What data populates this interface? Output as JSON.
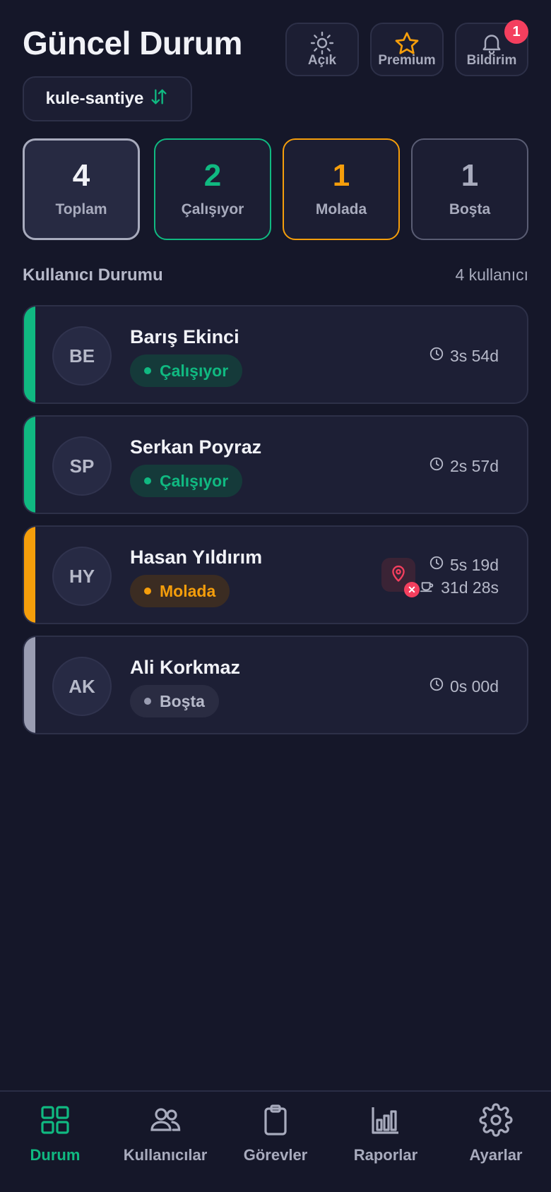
{
  "header": {
    "title": "Güncel Durum",
    "buttons": [
      {
        "label": "Açık",
        "icon": "sun-icon"
      },
      {
        "label": "Premium",
        "icon": "star-icon"
      },
      {
        "label": "Bildirim",
        "icon": "bell-icon",
        "badge": "1"
      }
    ],
    "project": "kule-santiye"
  },
  "stats": [
    {
      "value": "4",
      "label": "Toplam",
      "color": "#f1f2f7"
    },
    {
      "value": "2",
      "label": "Çalışıyor",
      "color": "#10b981"
    },
    {
      "value": "1",
      "label": "Molada",
      "color": "#f59e0b"
    },
    {
      "value": "1",
      "label": "Boşta",
      "color": "#a8abbd"
    }
  ],
  "section": {
    "title": "Kullanıcı Durumu",
    "count": "4 kullanıcı"
  },
  "users": [
    {
      "initials": "BE",
      "name": "Barış Ekinci",
      "status": "Çalışıyor",
      "status_color": "#10b981",
      "work_time": "3s 54d"
    },
    {
      "initials": "SP",
      "name": "Serkan Poyraz",
      "status": "Çalışıyor",
      "status_color": "#10b981",
      "work_time": "2s 57d"
    },
    {
      "initials": "HY",
      "name": "Hasan Yıldırım",
      "status": "Molada",
      "status_color": "#f59e0b",
      "work_time": "5s 19d",
      "break_time": "31d 28s",
      "location_flag": "location-off-icon"
    },
    {
      "initials": "AK",
      "name": "Ali Korkmaz",
      "status": "Boşta",
      "status_color": "#9a9db2",
      "work_time": "0s 00d"
    }
  ],
  "nav": [
    {
      "label": "Durum",
      "icon": "grid-icon",
      "active": true
    },
    {
      "label": "Kullanıcılar",
      "icon": "users-icon"
    },
    {
      "label": "Görevler",
      "icon": "clipboard-icon"
    },
    {
      "label": "Raporlar",
      "icon": "bar-chart-icon"
    },
    {
      "label": "Ayarlar",
      "icon": "gear-icon"
    }
  ],
  "colors": {
    "accent": "#10b981",
    "warning": "#f59e0b",
    "danger": "#f43f5e",
    "background": "#151729"
  }
}
